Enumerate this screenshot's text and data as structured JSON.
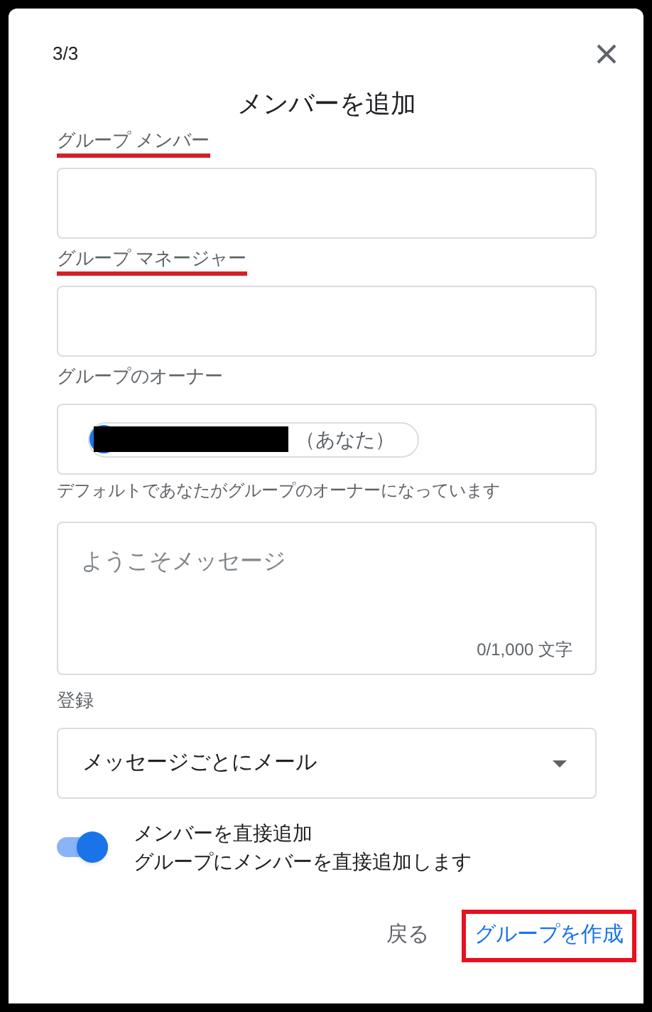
{
  "dialog": {
    "step": "3/3",
    "title": "メンバーを追加"
  },
  "fields": [
    {
      "kind": "input",
      "label": "グループ メンバー",
      "highlighted": true
    },
    {
      "kind": "input",
      "label": "グループ マネージャー",
      "highlighted": true
    },
    {
      "kind": "owner",
      "label": "グループのオーナー",
      "highlighted": false,
      "chip_suffix": "（あなた）",
      "hint": "デフォルトであなたがグループのオーナーになっています"
    },
    {
      "kind": "textarea",
      "placeholder": "ようこそメッセージ",
      "counter": "0/1,000 文字"
    },
    {
      "kind": "select",
      "label": "登録",
      "highlighted": false,
      "value": "メッセージごとにメール"
    }
  ],
  "toggle": {
    "on": true,
    "title": "メンバーを直接追加",
    "description": "グループにメンバーを直接追加します"
  },
  "buttons": [
    {
      "kind": "text",
      "label": "戻る",
      "highlighted": false
    },
    {
      "kind": "primary",
      "label": "グループを作成",
      "highlighted": true
    }
  ]
}
